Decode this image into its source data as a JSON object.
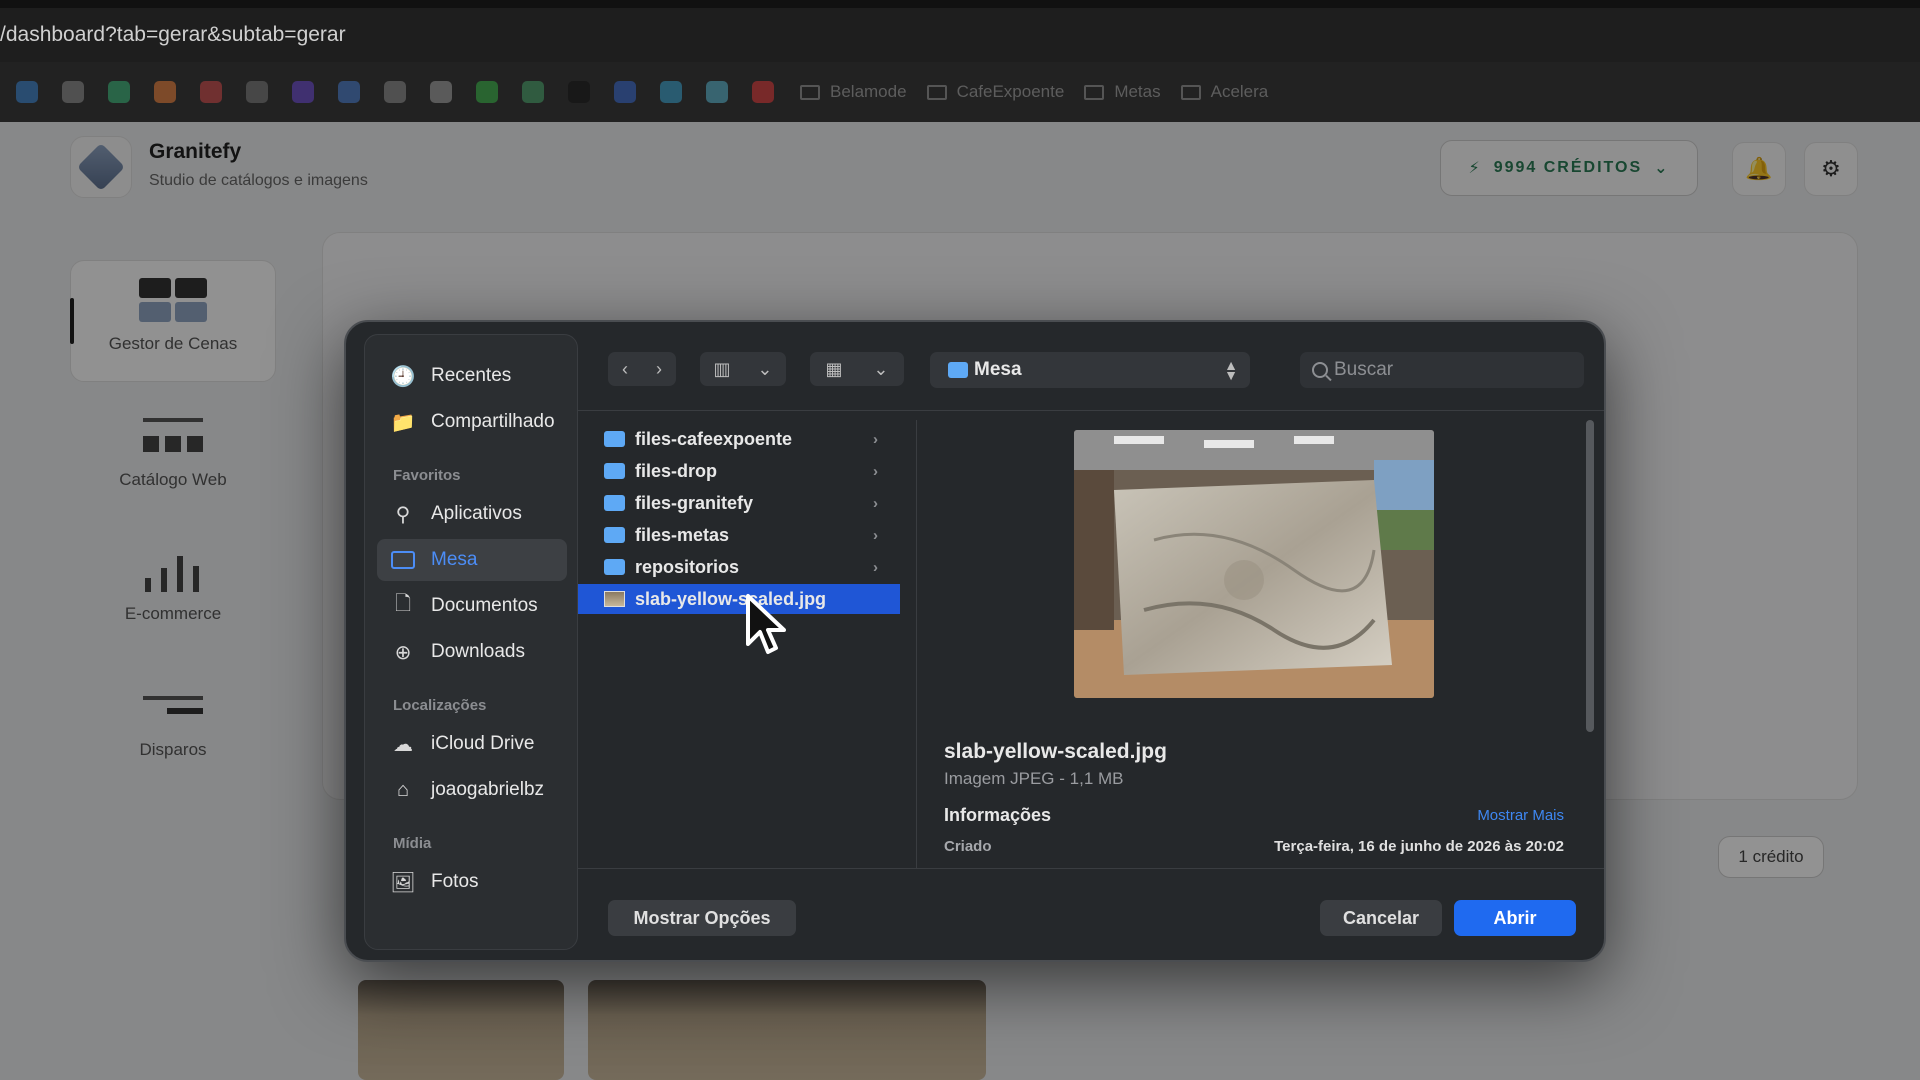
{
  "browser": {
    "url": "/dashboard?tab=gerar&subtab=gerar",
    "bookmark_folders": [
      "Belamode",
      "CafeExpoente",
      "Metas",
      "Acelera"
    ]
  },
  "app": {
    "name": "Granitefy",
    "subtitle": "Studio de catálogos e imagens",
    "credits_label": "9994 CRÉDITOS",
    "sidebar": [
      "Gestor de Cenas",
      "Catálogo Web",
      "E-commerce",
      "Disparos"
    ],
    "credit_pill": "1 crédito"
  },
  "dialog": {
    "sidebar": {
      "recent": "Recentes",
      "shared": "Compartilhado",
      "favorites_title": "Favoritos",
      "favorites": [
        "Aplicativos",
        "Mesa",
        "Documentos",
        "Downloads"
      ],
      "locations_title": "Localizações",
      "locations": [
        "iCloud Drive",
        "joaogabrielbz"
      ],
      "media_title": "Mídia",
      "media": [
        "Fotos"
      ]
    },
    "location": "Mesa",
    "search_placeholder": "Buscar",
    "files": [
      {
        "name": "files-cafeexpoente",
        "kind": "folder"
      },
      {
        "name": "files-drop",
        "kind": "folder"
      },
      {
        "name": "files-granitefy",
        "kind": "folder"
      },
      {
        "name": "files-metas",
        "kind": "folder"
      },
      {
        "name": "repositorios",
        "kind": "folder"
      },
      {
        "name": "slab-yellow-scaled.jpg",
        "kind": "image",
        "selected": true
      }
    ],
    "preview": {
      "file_name": "slab-yellow-scaled.jpg",
      "file_type": "Imagem JPEG - 1,1 MB",
      "info_title": "Informações",
      "more": "Mostrar Mais",
      "created_label": "Criado",
      "created_value": "Terça-feira, 16 de junho de 2026 às 20:02"
    },
    "buttons": {
      "options": "Mostrar Opções",
      "cancel": "Cancelar",
      "open": "Abrir"
    }
  },
  "colors": {
    "accent": "#1f6af0",
    "selection": "#1f56d6",
    "folder": "#5ea9f5",
    "credits": "#2a7a55"
  }
}
